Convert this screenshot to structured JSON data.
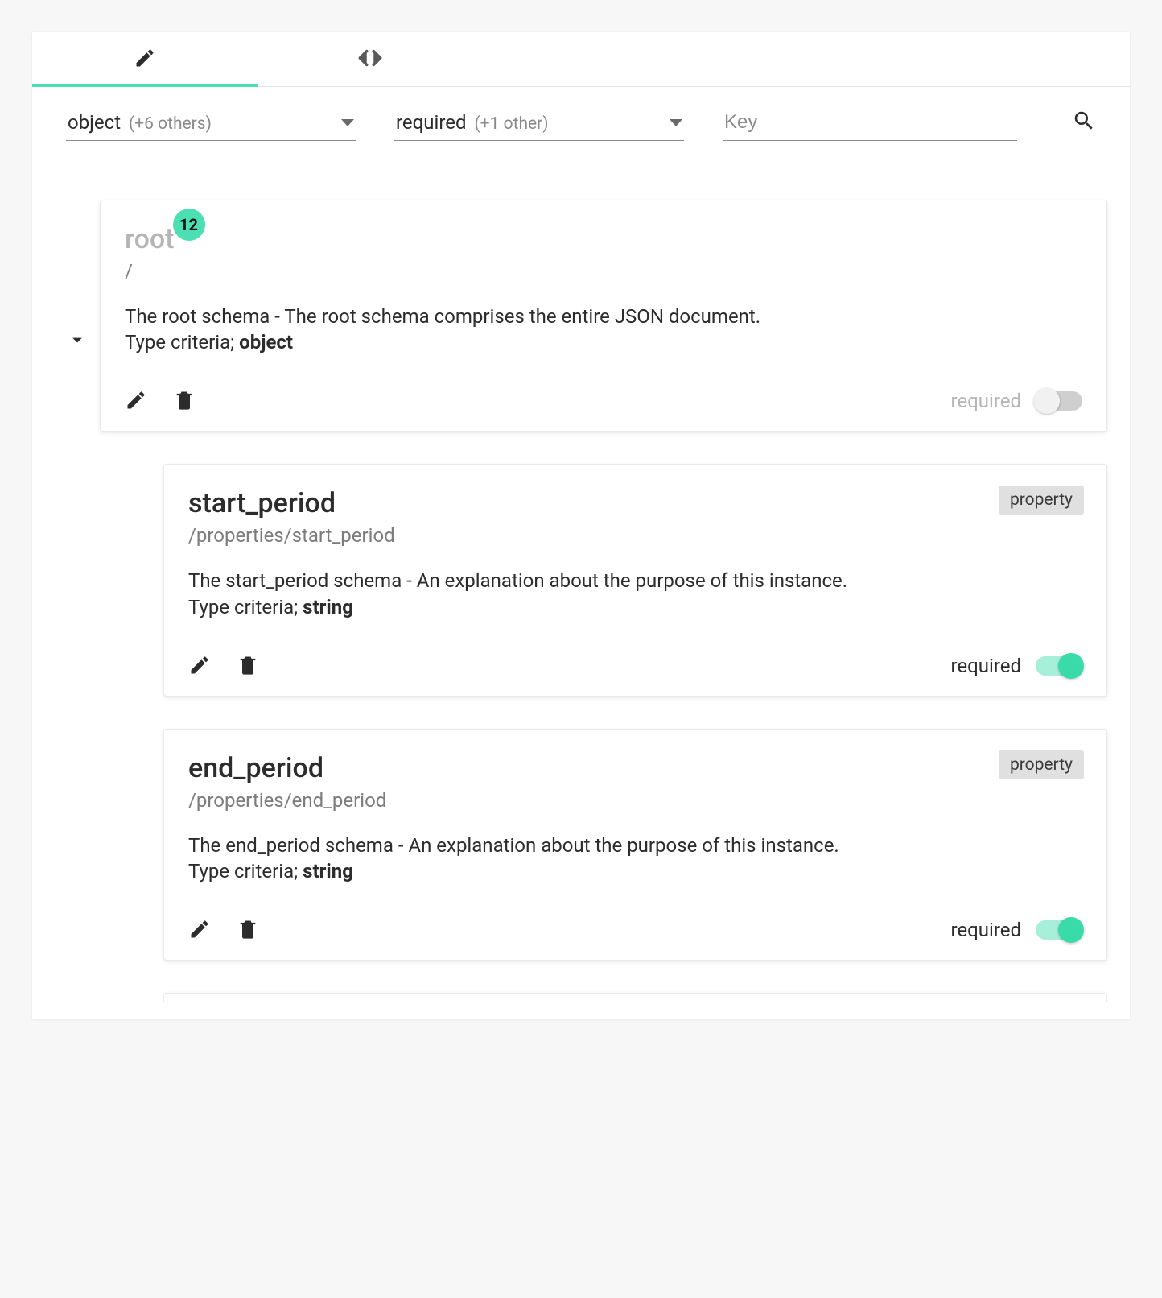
{
  "tabs": {
    "edit_icon": "pencil",
    "code_icon": "angle-brackets"
  },
  "filters": {
    "type": {
      "label": "object",
      "sub": "(+6 others)"
    },
    "required": {
      "label": "required",
      "sub": "(+1 other)"
    },
    "key_placeholder": "Key"
  },
  "labels": {
    "type_criteria_prefix": "Type criteria; ",
    "required": "required",
    "property_tag": "property"
  },
  "root": {
    "title": "root",
    "badge": "12",
    "path": "/",
    "description": "The root schema - The root schema comprises the entire JSON document.",
    "type": "object",
    "required_on": false
  },
  "properties": [
    {
      "title": "start_period",
      "path": "/properties/start_period",
      "description": "The start_period schema - An explanation about the purpose of this instance.",
      "type": "string",
      "required_on": true
    },
    {
      "title": "end_period",
      "path": "/properties/end_period",
      "description": "The end_period schema - An explanation about the purpose of this instance.",
      "type": "string",
      "required_on": true
    }
  ]
}
